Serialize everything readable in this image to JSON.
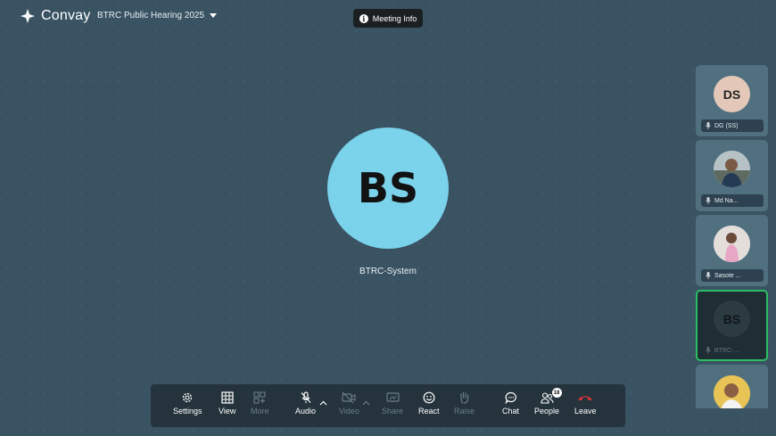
{
  "header": {
    "brand": "Convay",
    "meeting_title": "BTRC Public Hearing 2025",
    "meeting_info_label": "Meeting Info"
  },
  "main": {
    "avatar_initials": "BS",
    "avatar_color": "#7ad3ea",
    "participant_name": "BTRC-System"
  },
  "sidebar": {
    "tiles": [
      {
        "initials": "DS",
        "label": "DG (SS)",
        "avatar_type": "initials",
        "avatar_color": "#e3c8b9"
      },
      {
        "initials": "",
        "label": "Md Na...",
        "avatar_type": "photo"
      },
      {
        "initials": "",
        "label": "Sasote ...",
        "avatar_type": "photo"
      },
      {
        "initials": "BS",
        "label": "BTRC-...",
        "avatar_type": "initials",
        "avatar_color": "#2c3a41",
        "active": true
      },
      {
        "initials": "",
        "label": "",
        "avatar_type": "photo"
      }
    ]
  },
  "toolbar": {
    "settings": "Settings",
    "view": "View",
    "more": "More",
    "audio": "Audio",
    "video": "Video",
    "share": "Share",
    "react": "React",
    "raise": "Raise",
    "chat": "Chat",
    "people": "People",
    "people_count": "18",
    "leave": "Leave",
    "leave_color": "#e5333a"
  }
}
